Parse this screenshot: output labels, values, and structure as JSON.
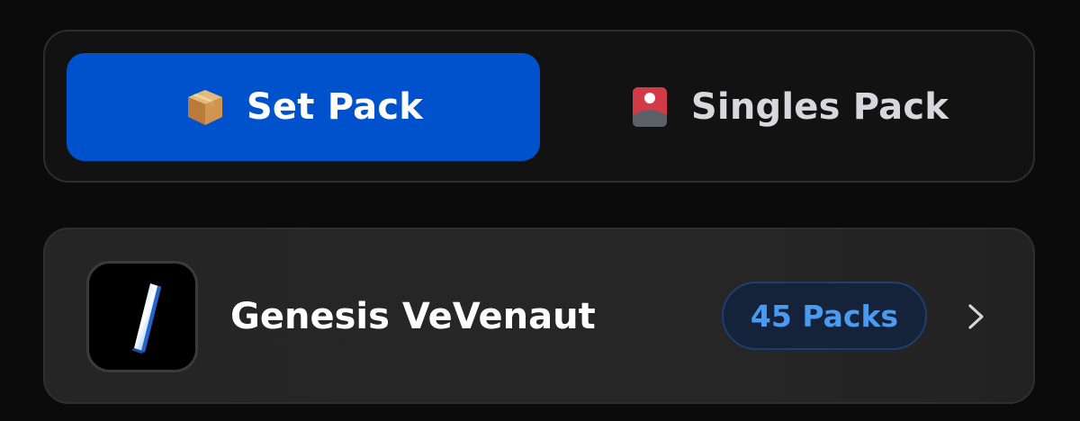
{
  "tabs": {
    "items": [
      {
        "label": "Set Pack",
        "icon": "package-icon",
        "selected": true
      },
      {
        "label": "Singles Pack",
        "icon": "card-icon",
        "selected": false
      }
    ],
    "accent_color": "#0052cc"
  },
  "packs": [
    {
      "name": "Genesis VeVenaut",
      "badge": "45 Packs",
      "thumbnail": "pack-thumbnail",
      "badge_color": "#4a9af0"
    }
  ]
}
